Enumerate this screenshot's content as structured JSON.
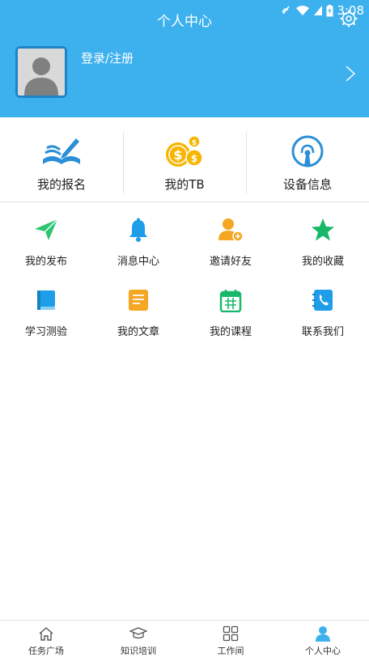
{
  "status_bar": {
    "time": "3:08"
  },
  "header": {
    "title": "个人中心",
    "login_text": "登录/注册"
  },
  "stats": [
    {
      "label": "我的报名",
      "icon": "book-pen-icon"
    },
    {
      "label": "我的TB",
      "icon": "coins-icon"
    },
    {
      "label": "设备信息",
      "icon": "device-signal-icon"
    }
  ],
  "grid": [
    {
      "label": "我的发布",
      "icon": "paper-plane-icon"
    },
    {
      "label": "消息中心",
      "icon": "bell-icon"
    },
    {
      "label": "邀请好友",
      "icon": "add-friend-icon"
    },
    {
      "label": "我的收藏",
      "icon": "star-icon"
    },
    {
      "label": "学习测验",
      "icon": "book-icon"
    },
    {
      "label": "我的文章",
      "icon": "document-icon"
    },
    {
      "label": "我的课程",
      "icon": "calendar-icon"
    },
    {
      "label": "联系我们",
      "icon": "phone-book-icon"
    }
  ],
  "bottom_nav": [
    {
      "label": "任务广场",
      "icon": "home-icon"
    },
    {
      "label": "知识培训",
      "icon": "graduation-cap-icon"
    },
    {
      "label": "工作间",
      "icon": "grid-icon"
    },
    {
      "label": "个人中心",
      "icon": "person-icon",
      "active": true
    }
  ],
  "colors": {
    "header_bg": "#3db1ee",
    "active_tab": "#3db1ee"
  }
}
